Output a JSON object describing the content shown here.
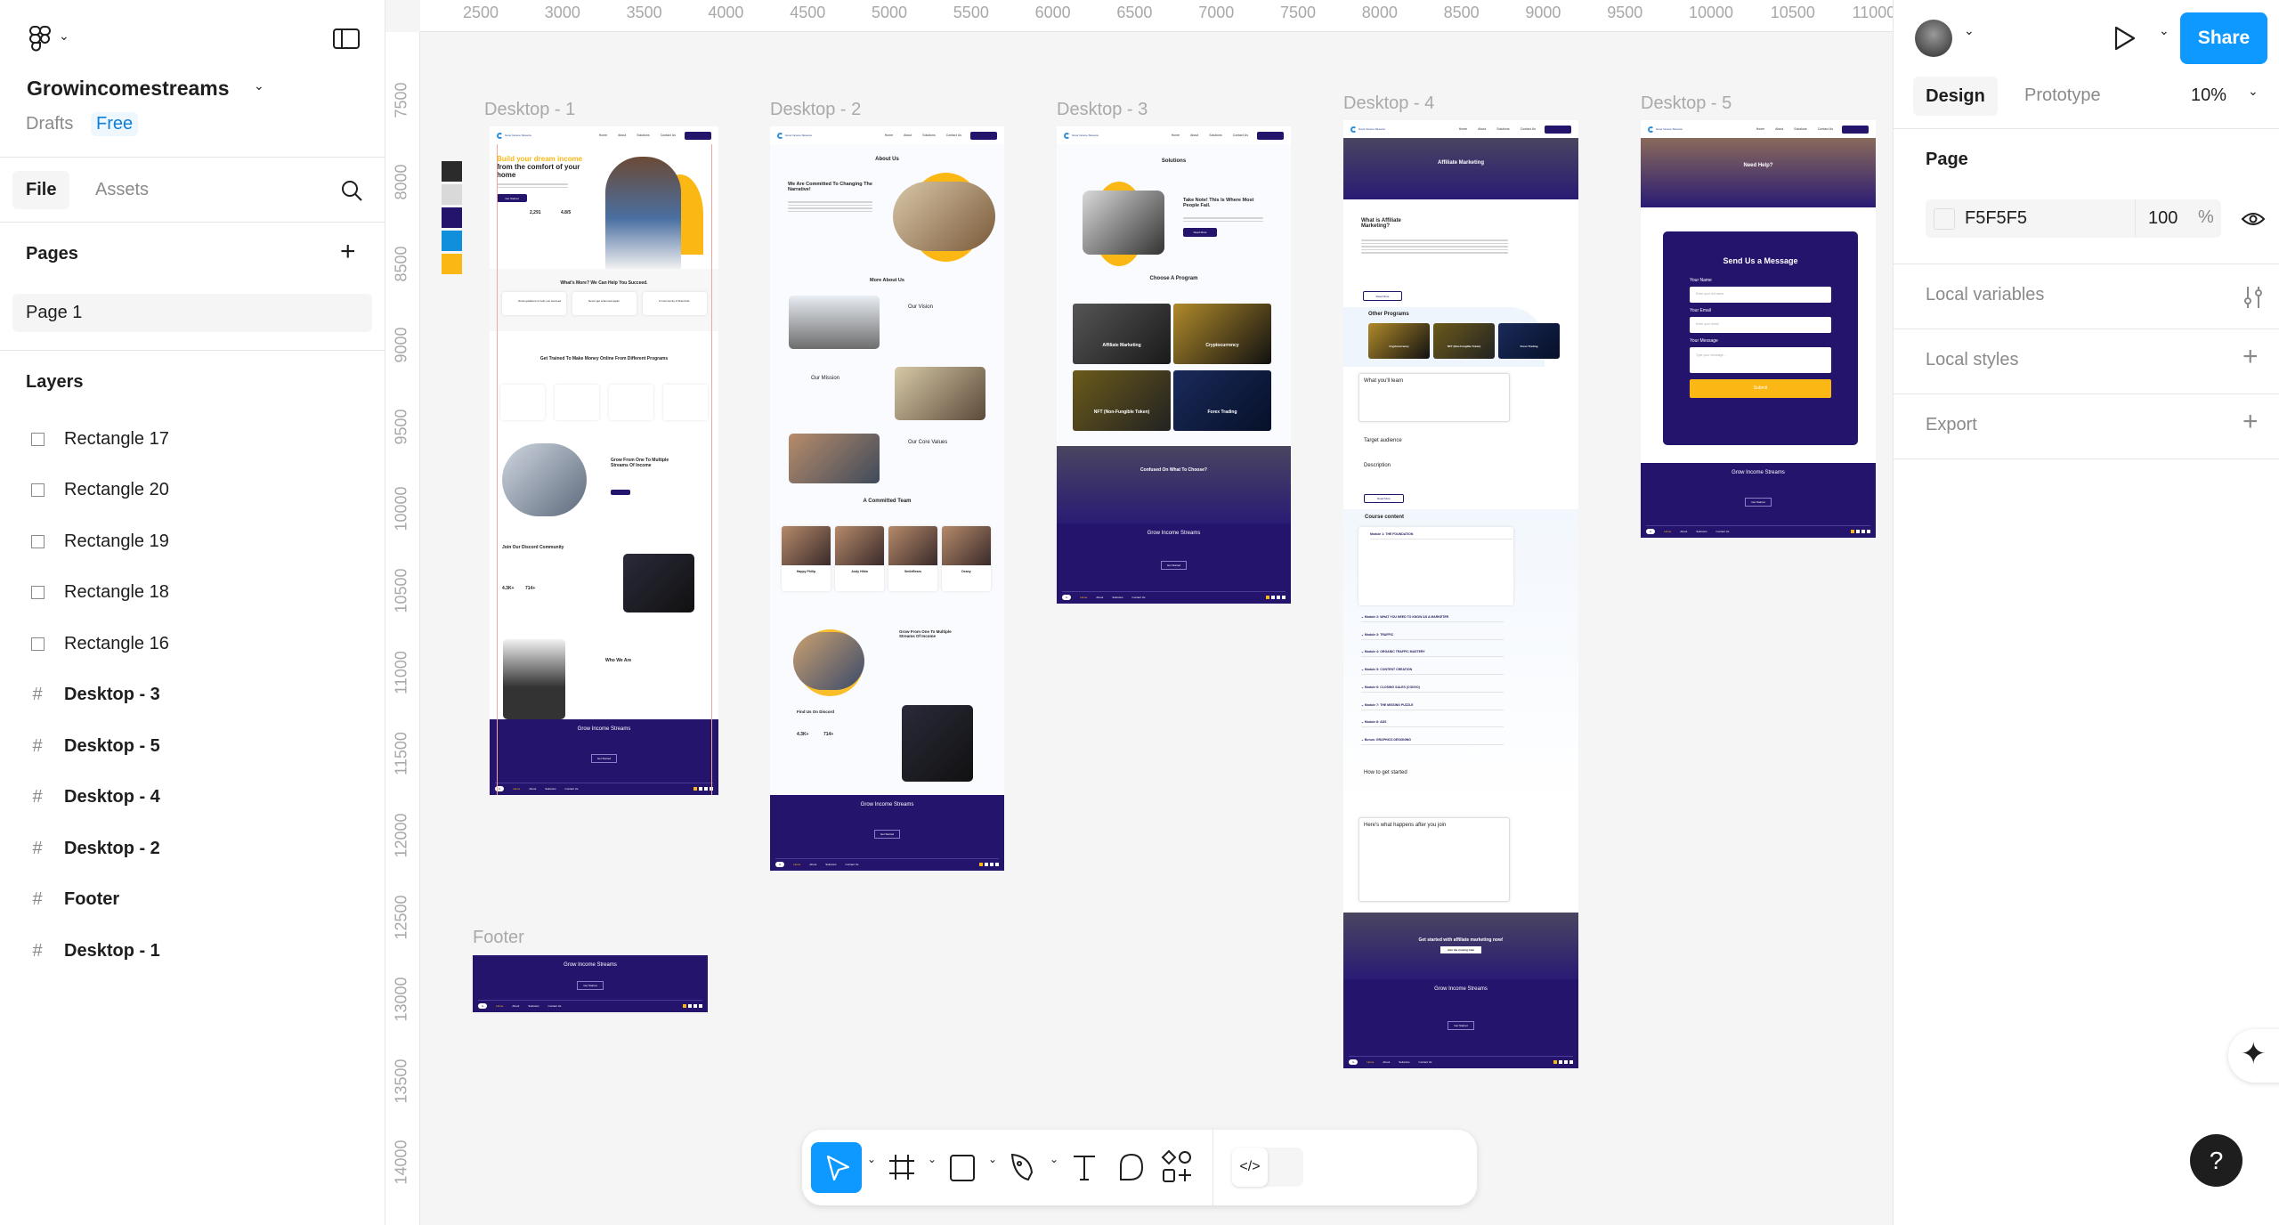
{
  "file": {
    "name": "Growincomestreams",
    "location": "Drafts",
    "plan": "Free"
  },
  "left_tabs": [
    "File",
    "Assets"
  ],
  "pages": {
    "title": "Pages",
    "items": [
      "Page 1"
    ]
  },
  "layers": {
    "title": "Layers",
    "items": [
      {
        "name": "Rectangle 17",
        "type": "rectangle"
      },
      {
        "name": "Rectangle 20",
        "type": "rectangle"
      },
      {
        "name": "Rectangle 19",
        "type": "rectangle"
      },
      {
        "name": "Rectangle 18",
        "type": "rectangle"
      },
      {
        "name": "Rectangle 16",
        "type": "rectangle"
      },
      {
        "name": "Desktop - 3",
        "type": "frame"
      },
      {
        "name": "Desktop - 5",
        "type": "frame"
      },
      {
        "name": "Desktop - 4",
        "type": "frame"
      },
      {
        "name": "Desktop - 2",
        "type": "frame"
      },
      {
        "name": "Footer",
        "type": "frame"
      },
      {
        "name": "Desktop - 1",
        "type": "frame"
      }
    ]
  },
  "ruler": {
    "x": [
      "2500",
      "3000",
      "3500",
      "4000",
      "4500",
      "5000",
      "5500",
      "6000",
      "6500",
      "7000",
      "7500",
      "8000",
      "8500",
      "9000",
      "9500",
      "10000",
      "10500",
      "11000"
    ],
    "y": [
      "7500",
      "8000",
      "8500",
      "9000",
      "9500",
      "10000",
      "10500",
      "11000",
      "11500",
      "12000",
      "12500",
      "13000",
      "13500",
      "14000"
    ]
  },
  "swatches": [
    "#2b2b2b",
    "#d9d9d9",
    "#24146b",
    "#0f8fdc",
    "#fbb714"
  ],
  "right": {
    "share": "Share",
    "tabs": [
      "Design",
      "Prototype"
    ],
    "zoom": "10%",
    "page_section": "Page",
    "page_fill": {
      "hex": "F5F5F5",
      "opacity": "100",
      "unit": "%"
    },
    "sections": [
      "Local variables",
      "Local styles",
      "Export"
    ]
  },
  "colors": {
    "accent": "#0d99ff",
    "brand_purple": "#24146b",
    "brand_yellow": "#fbb714",
    "canvas": "#f5f5f5"
  },
  "site": {
    "logo": "Grow Income Streams",
    "nav": [
      "Home",
      "About",
      "Solutions",
      "Contact Us"
    ],
    "footer": {
      "title": "Grow Income Streams",
      "button": "Get Started",
      "links": [
        "Home",
        "About",
        "Solutions",
        "Contact Us"
      ]
    }
  },
  "frames": {
    "d1": {
      "label": "Desktop - 1",
      "hero_accent": "Build your dream income",
      "hero_rest": "from the comfort of your home",
      "cta": "Get Started",
      "stat1": "2,291",
      "stat2": "4.8/5",
      "s1": "What's More? We Can Help You Succeed.",
      "f1": "Great guidance to help you succeed",
      "f2": "Never get scammed again",
      "f3": "A Community of likeminds",
      "s2": "Get Trained To Make Money Online From Different Programs",
      "s3": "Grow From One To Multiple Streams Of Income",
      "s4": "Join Our Discord Community",
      "n1": "4.3K+",
      "n2": "714+",
      "s5": "Who We Are"
    },
    "d2": {
      "label": "Desktop - 2",
      "title": "About Us",
      "h1": "We Are Committed To Changing The Narrative!",
      "more": "More About Us",
      "vision": "Our Vision",
      "mission": "Our Mission",
      "values": "Our Core Values",
      "team": "A Committed Team",
      "members": [
        "Happy Philip",
        "Andy Hilda",
        "SmileBears",
        "Deany"
      ],
      "grow": "Grow From One To Multiple Streams Of Income",
      "discord": "Find Us On Discord",
      "n1": "4.3K+",
      "n2": "714+"
    },
    "d3": {
      "label": "Desktop - 3",
      "title": "Solutions",
      "h1": "Take Note! This Is Where Most People Fail.",
      "read": "Read More",
      "choose": "Choose A Program",
      "programs": [
        "Affiliate Marketing",
        "Cryptocurrency",
        "NFT (Non-Fungible Token)",
        "Forex Trading"
      ],
      "confused": "Confused On What To Choose?"
    },
    "d4": {
      "label": "Desktop - 4",
      "hero": "Affiliate Marketing",
      "what": "What is Affiliate Marketing?",
      "read": "Read More",
      "other": "Other Programs",
      "others": [
        "Cryptocurrency",
        "NFT (Non-Fungible Token)",
        "Forex Trading"
      ],
      "learn": "What you'll learn",
      "target": "Target audience",
      "desc": "Description",
      "course": "Course content",
      "modules": [
        "Module 1: THE FOUNDATION",
        "Module 2: WHAT YOU NEED TO KNOW AS A MARKETER",
        "Module 3: TRAFFIC",
        "Module 4: ORGANIC TRAFFIC MASTERY",
        "Module 5: CONTENT CREATION",
        "Module 6: CLOSING SALES (CONVO)",
        "Module 7: THE MISSING PUZZLE",
        "Module 8: ADS",
        "Bonus: GRAPHICS DESIGNING"
      ],
      "start": "How to get started",
      "after": "Here's what happens after you join",
      "cta": "Get started with affiliate marketing now!",
      "cta_btn": "Join the moving train"
    },
    "d5": {
      "label": "Desktop - 5",
      "hero": "Need Help?",
      "form_title": "Send Us a Message",
      "name_label": "Your Name",
      "name_ph": "Enter your full name",
      "email_label": "Your Email",
      "email_ph": "Enter your email",
      "msg_label": "Your Message",
      "msg_ph": "Type your message...",
      "submit": "Submit"
    },
    "footer": {
      "label": "Footer"
    }
  }
}
